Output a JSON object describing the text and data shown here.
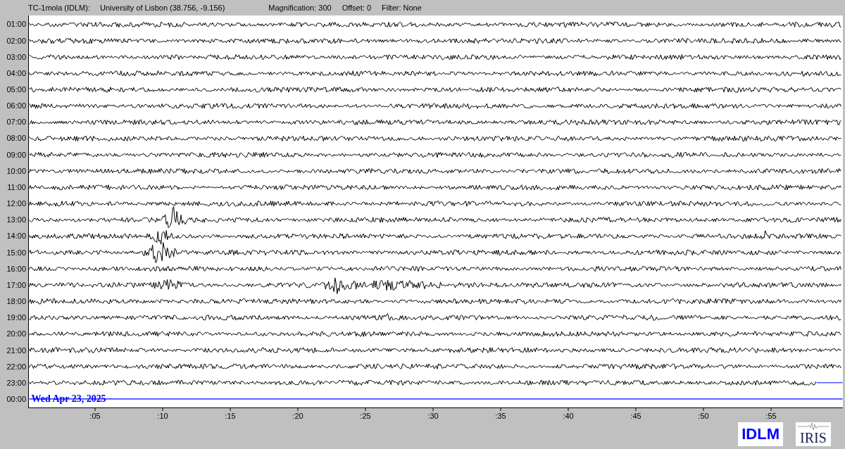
{
  "header": {
    "station": "TC-1mola (IDLM):",
    "location": "University of Lisbon (38.756, -9.156)",
    "magnification": "Magnification: 300",
    "offset": "Offset: 0",
    "filter": "Filter: None"
  },
  "rows": [
    {
      "time": "01:00",
      "kind": "trace"
    },
    {
      "time": "02:00",
      "kind": "trace"
    },
    {
      "time": "03:00",
      "kind": "trace"
    },
    {
      "time": "04:00",
      "kind": "trace"
    },
    {
      "time": "05:00",
      "kind": "trace"
    },
    {
      "time": "06:00",
      "kind": "trace"
    },
    {
      "time": "07:00",
      "kind": "trace"
    },
    {
      "time": "08:00",
      "kind": "trace"
    },
    {
      "time": "09:00",
      "kind": "trace"
    },
    {
      "time": "10:00",
      "kind": "trace"
    },
    {
      "time": "11:00",
      "kind": "trace"
    },
    {
      "time": "12:00",
      "kind": "trace"
    },
    {
      "time": "13:00",
      "kind": "trace"
    },
    {
      "time": "14:00",
      "kind": "trace"
    },
    {
      "time": "15:00",
      "kind": "trace"
    },
    {
      "time": "16:00",
      "kind": "trace"
    },
    {
      "time": "17:00",
      "kind": "trace"
    },
    {
      "time": "18:00",
      "kind": "trace"
    },
    {
      "time": "19:00",
      "kind": "trace"
    },
    {
      "time": "20:00",
      "kind": "trace"
    },
    {
      "time": "21:00",
      "kind": "trace"
    },
    {
      "time": "22:00",
      "kind": "trace"
    },
    {
      "time": "23:00",
      "kind": "partial"
    },
    {
      "time": "00:00",
      "kind": "current"
    }
  ],
  "date_label": "Wed Apr 23, 2025",
  "x_ticks": [
    ":05",
    ":10",
    ":15",
    ":20",
    ":25",
    ":30",
    ":35",
    ":40",
    ":45",
    ":50",
    ":55"
  ],
  "logos": {
    "idlm": "IDLM",
    "iris": "IRIS"
  }
}
